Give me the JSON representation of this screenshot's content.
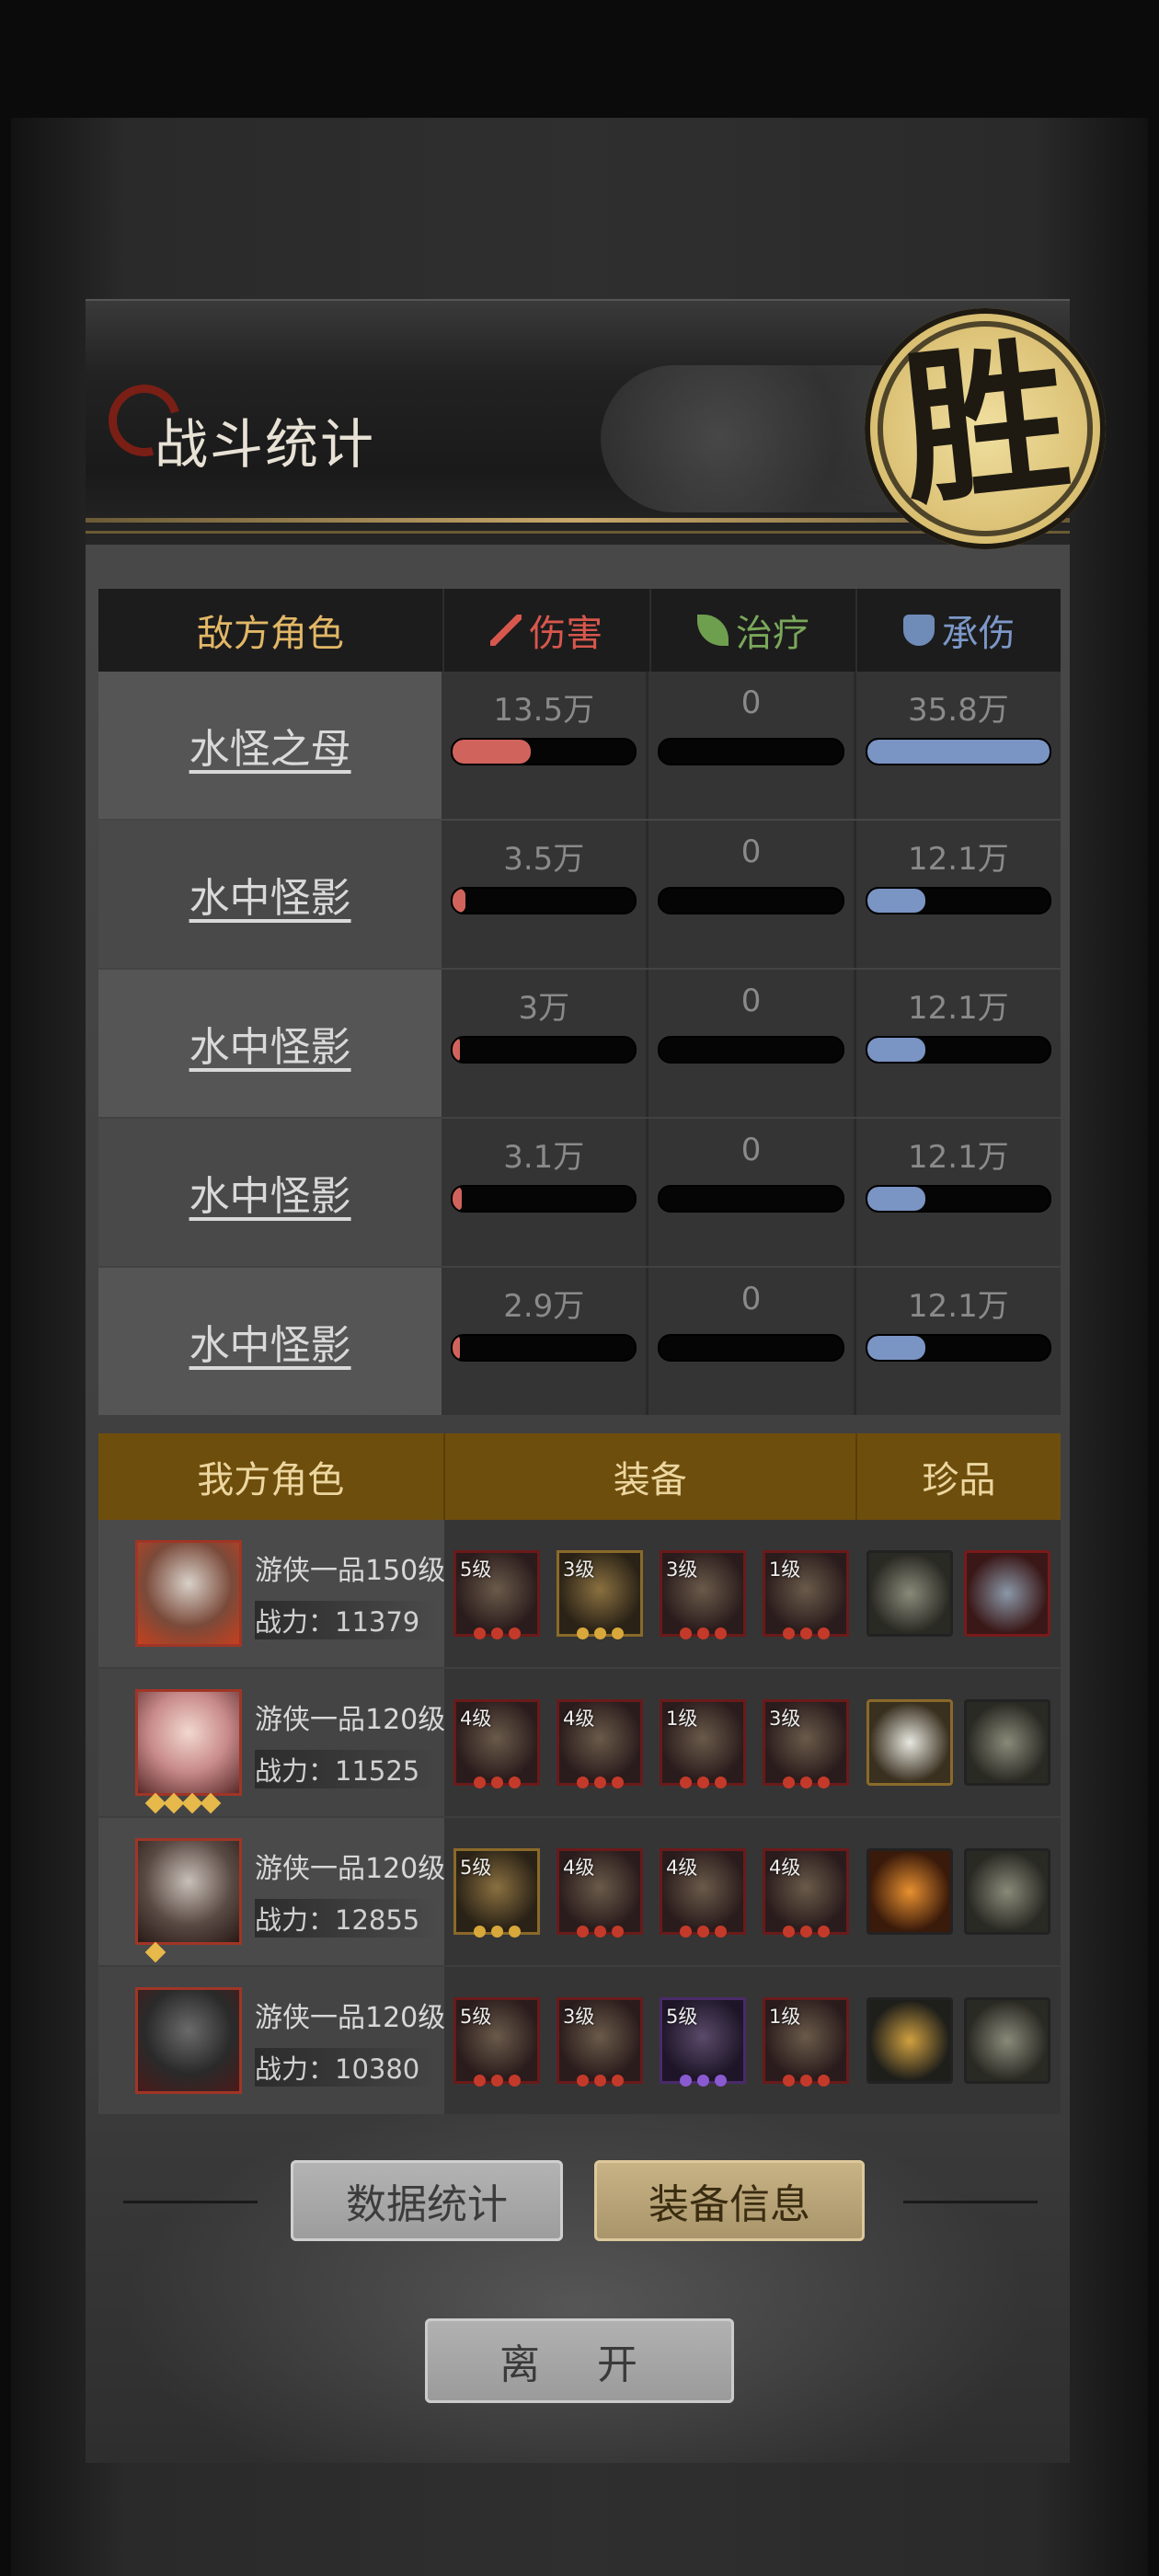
{
  "header": {
    "title": "战斗统计",
    "result_seal": "胜"
  },
  "enemy_table": {
    "headers": {
      "role": "敌方角色",
      "damage": "伤害",
      "heal": "治疗",
      "tank": "承伤"
    },
    "rows": [
      {
        "name": "水怪之母",
        "damage": "13.5万",
        "heal": "0",
        "tank": "35.8万",
        "damage_fill": 0.43,
        "heal_fill": 0,
        "tank_fill": 1.0
      },
      {
        "name": "水中怪影",
        "damage": "3.5万",
        "heal": "0",
        "tank": "12.1万",
        "damage_fill": 0.07,
        "heal_fill": 0,
        "tank_fill": 0.32
      },
      {
        "name": "水中怪影",
        "damage": "3万",
        "heal": "0",
        "tank": "12.1万",
        "damage_fill": 0.04,
        "heal_fill": 0,
        "tank_fill": 0.32
      },
      {
        "name": "水中怪影",
        "damage": "3.1万",
        "heal": "0",
        "tank": "12.1万",
        "damage_fill": 0.05,
        "heal_fill": 0,
        "tank_fill": 0.32
      },
      {
        "name": "水中怪影",
        "damage": "2.9万",
        "heal": "0",
        "tank": "12.1万",
        "damage_fill": 0.04,
        "heal_fill": 0,
        "tank_fill": 0.32
      }
    ]
  },
  "ally_table": {
    "headers": {
      "role": "我方角色",
      "equipment": "装备",
      "treasure": "珍品"
    },
    "rows": [
      {
        "title": "游侠一品150级",
        "power": "战力：11379",
        "stars": 0,
        "gear": [
          {
            "level": "5级",
            "pips": 3,
            "tier": "red"
          },
          {
            "level": "3级",
            "pips": 3,
            "tier": "gold"
          },
          {
            "level": "3级",
            "pips": 3,
            "tier": "red"
          },
          {
            "level": "1级",
            "pips": 3,
            "tier": "red"
          }
        ],
        "treasures": [
          "comb",
          "stone"
        ]
      },
      {
        "title": "游侠一品120级",
        "power": "战力：11525",
        "stars": 4,
        "gear": [
          {
            "level": "4级",
            "pips": 3,
            "tier": "red"
          },
          {
            "level": "4级",
            "pips": 3,
            "tier": "red"
          },
          {
            "level": "1级",
            "pips": 3,
            "tier": "red"
          },
          {
            "level": "3级",
            "pips": 3,
            "tier": "red"
          }
        ],
        "treasures": [
          "jade-rabbit",
          "bowl"
        ]
      },
      {
        "title": "游侠一品120级",
        "power": "战力：12855",
        "stars": 1,
        "gear": [
          {
            "level": "5级",
            "pips": 3,
            "tier": "gold"
          },
          {
            "level": "4级",
            "pips": 3,
            "tier": "red"
          },
          {
            "level": "4级",
            "pips": 3,
            "tier": "red"
          },
          {
            "level": "4级",
            "pips": 3,
            "tier": "red"
          }
        ],
        "treasures": [
          "amber",
          "mushroom"
        ]
      },
      {
        "title": "游侠一品120级",
        "power": "战力：10380",
        "stars": 0,
        "gear": [
          {
            "level": "5级",
            "pips": 3,
            "tier": "red"
          },
          {
            "level": "3级",
            "pips": 3,
            "tier": "red"
          },
          {
            "level": "5级",
            "pips": 3,
            "tier": "purple"
          },
          {
            "level": "1级",
            "pips": 3,
            "tier": "red"
          }
        ],
        "treasures": [
          "hairpin",
          "comb"
        ]
      }
    ]
  },
  "buttons": {
    "stats": "数据统计",
    "equipment": "装备信息",
    "leave": "离 开"
  },
  "colors": {
    "damage": "#d0645c",
    "heal": "#6e9f4e",
    "tank": "#7a94c4",
    "accent_gold": "#e2b766"
  }
}
